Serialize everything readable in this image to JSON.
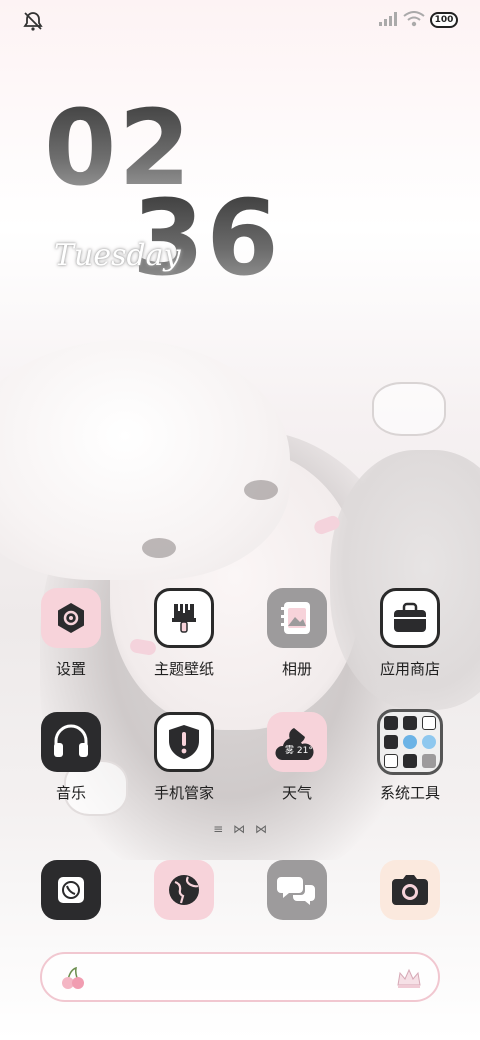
{
  "status_bar": {
    "mute_icon": "mute-icon",
    "signal_icon": "signal-icon",
    "wifi_icon": "wifi-icon",
    "battery_label": "100"
  },
  "clock": {
    "hours": "02",
    "minutes": "36",
    "weekday": "Tuesday"
  },
  "apps_row1": [
    {
      "label": "设置",
      "icon": "settings-icon"
    },
    {
      "label": "主题壁纸",
      "icon": "theme-brush-icon"
    },
    {
      "label": "相册",
      "icon": "photo-album-icon"
    },
    {
      "label": "应用商店",
      "icon": "store-bag-icon"
    }
  ],
  "apps_row2": [
    {
      "label": "音乐",
      "icon": "headphones-icon"
    },
    {
      "label": "手机管家",
      "icon": "shield-icon"
    },
    {
      "label": "天气",
      "icon": "weather-icon",
      "weather_text": "雾 21°"
    },
    {
      "label": "系统工具",
      "icon": "folder-icon"
    }
  ],
  "page_indicator": "≡",
  "dock": [
    {
      "icon": "phone-icon"
    },
    {
      "icon": "browser-globe-icon"
    },
    {
      "icon": "messages-icon"
    },
    {
      "icon": "camera-icon"
    }
  ],
  "colors": {
    "accent_pink": "#f7d3da",
    "dark": "#2b2b2d",
    "gray": "#9d9b9c"
  }
}
